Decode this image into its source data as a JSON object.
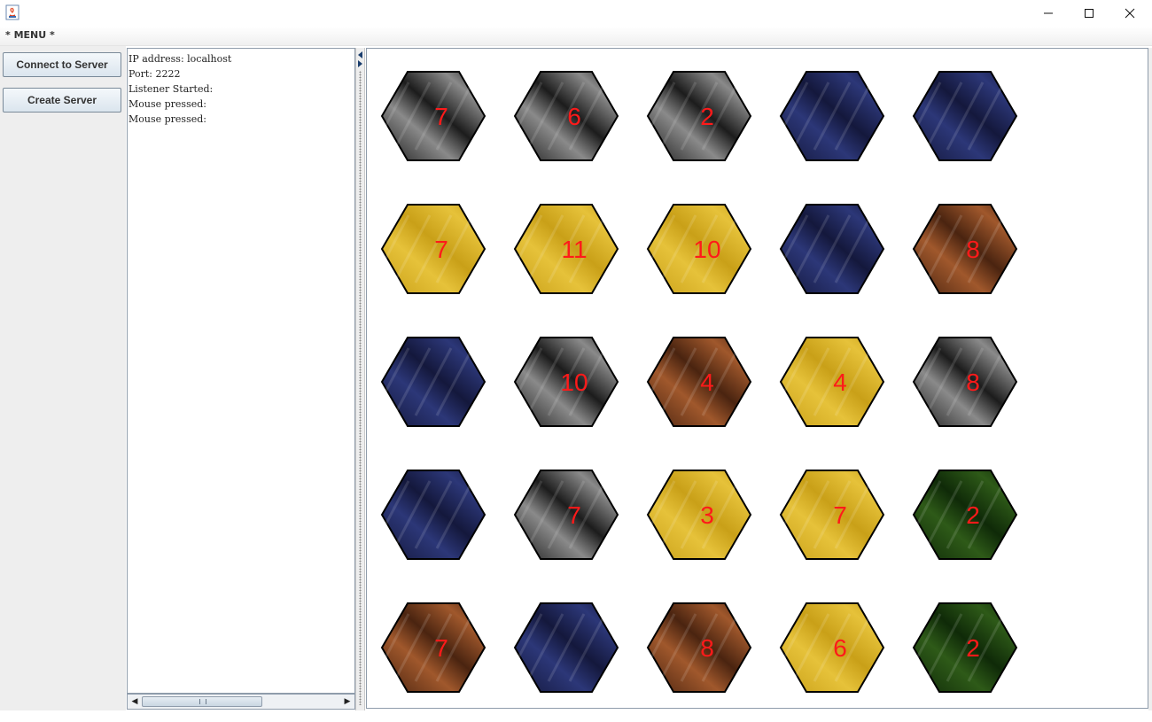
{
  "window": {
    "menu_title": "* MENU *",
    "icons": {
      "app": "java-app-icon",
      "minimize": "minimize-icon",
      "maximize": "maximize-icon",
      "close": "close-icon"
    }
  },
  "sidebar": {
    "connect_label": "Connect to Server",
    "create_label": "Create Server"
  },
  "log": {
    "lines": [
      "IP address: localhost",
      "Port: 2222",
      "Listener Started:",
      "Mouse pressed:",
      "Mouse pressed:"
    ]
  },
  "terrain_colors": {
    "stone": [
      "#1c1c1c",
      "#8a8a8a"
    ],
    "water": [
      "#14183c",
      "#2c3778"
    ],
    "wheat": [
      "#c9a018",
      "#e6c23a"
    ],
    "brick": [
      "#4a2410",
      "#a0582c"
    ],
    "forest": [
      "#0f2a08",
      "#2e5a18"
    ]
  },
  "board": {
    "rows": [
      [
        {
          "terrain": "stone",
          "number": "7"
        },
        {
          "terrain": "stone",
          "number": "6"
        },
        {
          "terrain": "stone",
          "number": "2"
        },
        {
          "terrain": "water",
          "number": ""
        },
        {
          "terrain": "water",
          "number": ""
        }
      ],
      [
        {
          "terrain": "wheat",
          "number": "7"
        },
        {
          "terrain": "wheat",
          "number": "11"
        },
        {
          "terrain": "wheat",
          "number": "10"
        },
        {
          "terrain": "water",
          "number": ""
        },
        {
          "terrain": "brick",
          "number": "8"
        }
      ],
      [
        {
          "terrain": "water",
          "number": ""
        },
        {
          "terrain": "stone",
          "number": "10"
        },
        {
          "terrain": "brick",
          "number": "4"
        },
        {
          "terrain": "wheat",
          "number": "4"
        },
        {
          "terrain": "stone",
          "number": "8"
        }
      ],
      [
        {
          "terrain": "water",
          "number": ""
        },
        {
          "terrain": "stone",
          "number": "7"
        },
        {
          "terrain": "wheat",
          "number": "3"
        },
        {
          "terrain": "wheat",
          "number": "7"
        },
        {
          "terrain": "forest",
          "number": "2"
        }
      ],
      [
        {
          "terrain": "brick",
          "number": "7"
        },
        {
          "terrain": "water",
          "number": ""
        },
        {
          "terrain": "brick",
          "number": "8"
        },
        {
          "terrain": "wheat",
          "number": "6"
        },
        {
          "terrain": "forest",
          "number": "2"
        }
      ]
    ]
  }
}
